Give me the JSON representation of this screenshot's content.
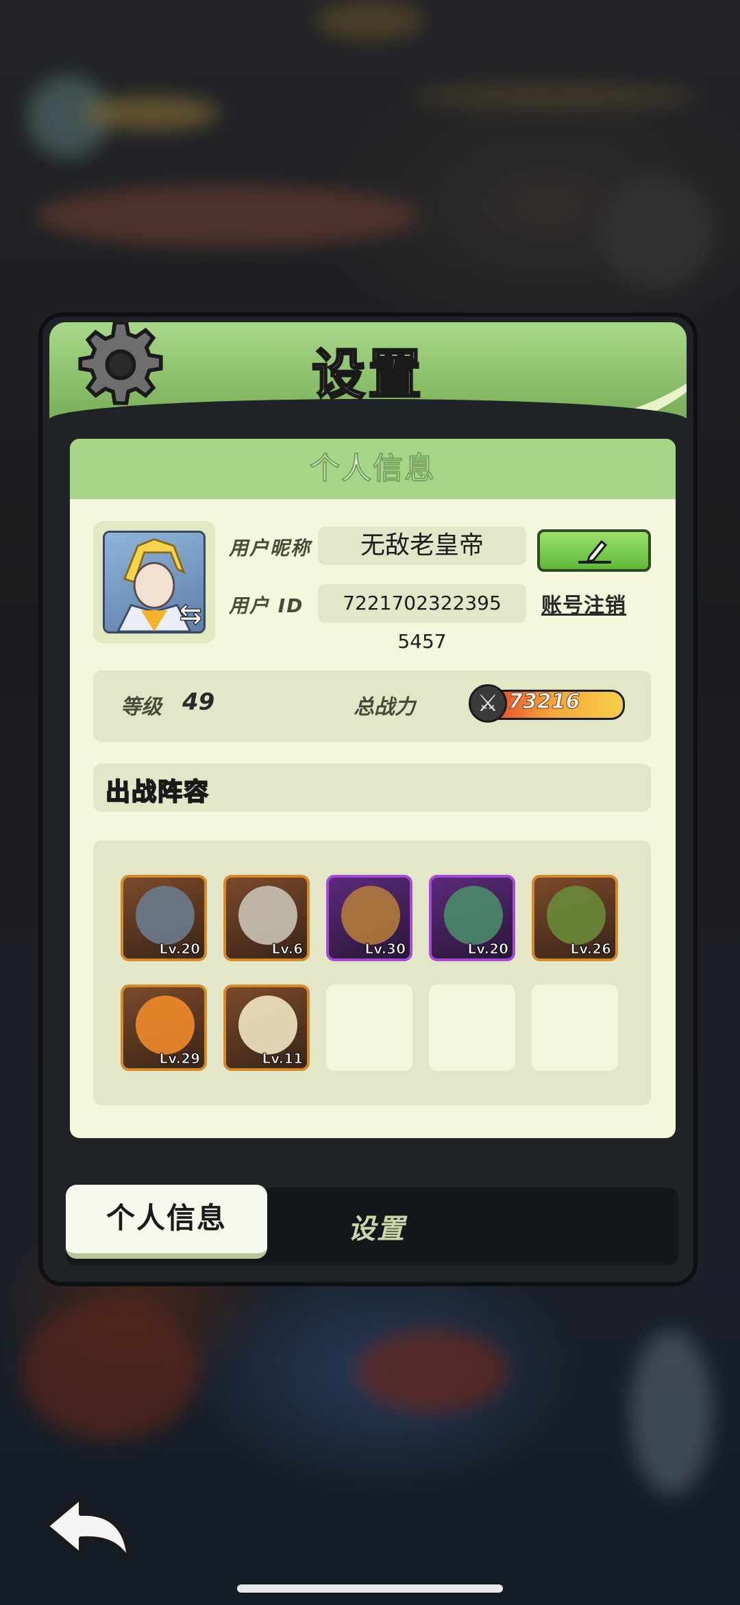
{
  "panel": {
    "title": "设置",
    "section_title": "个人信息"
  },
  "profile": {
    "nickname_label": "用户昵称",
    "nickname": "无敌老皇帝",
    "id_label": "用户 ID",
    "user_id": "7221702322395 5457",
    "logout_label": "账号注销",
    "level_label": "等级",
    "level": "49",
    "power_label": "总战力",
    "power": "73216"
  },
  "lineup": {
    "title": "出战阵容",
    "heroes": [
      {
        "level": "Lv.20",
        "rarity": "legend",
        "color": "#6b7a8c"
      },
      {
        "level": "Lv.6",
        "rarity": "legend",
        "color": "#c8c2b4"
      },
      {
        "level": "Lv.30",
        "rarity": "epic",
        "color": "#b07a3a"
      },
      {
        "level": "Lv.20",
        "rarity": "epic",
        "color": "#4a8a6a"
      },
      {
        "level": "Lv.26",
        "rarity": "legend",
        "color": "#6a8a3a"
      },
      {
        "level": "Lv.29",
        "rarity": "legend",
        "color": "#f08a2a"
      },
      {
        "level": "Lv.11",
        "rarity": "legend",
        "color": "#f0e6c4"
      }
    ],
    "empty_slots": 3
  },
  "tabs": {
    "personal": "个人信息",
    "settings": "设置"
  },
  "colors": {
    "header_green": "#8cc06a",
    "card_bg": "#f4f7dc",
    "accent_orange": "#d58a2a",
    "accent_purple": "#a64ad6"
  },
  "icons": [
    "gear-icon",
    "swap-icon",
    "pencil-icon",
    "sword-icon",
    "back-arrow-icon"
  ]
}
